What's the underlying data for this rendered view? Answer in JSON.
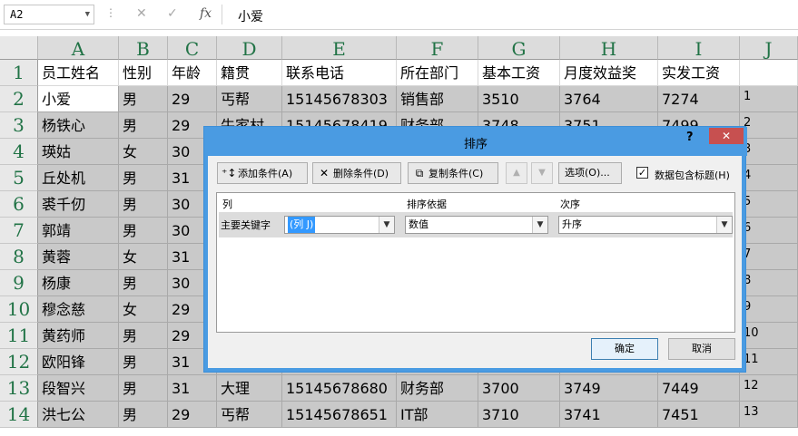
{
  "formula_bar": {
    "name_box": "A2",
    "cancel_icon": "✕",
    "enter_icon": "✓",
    "fx_label": "fx",
    "content": "小爱"
  },
  "columns": [
    "A",
    "B",
    "C",
    "D",
    "E",
    "F",
    "G",
    "H",
    "I",
    "J"
  ],
  "rows": [
    "1",
    "2",
    "3",
    "4",
    "5",
    "6",
    "7",
    "8",
    "9",
    "10",
    "11",
    "12",
    "13",
    "14"
  ],
  "header_row": [
    "员工姓名",
    "性别",
    "年龄",
    "籍贯",
    "联系电话",
    "所在部门",
    "基本工资",
    "月度效益奖",
    "实发工资",
    ""
  ],
  "data_rows": [
    [
      "小爱",
      "男",
      "29",
      "丐帮",
      "15145678303",
      "销售部",
      "3510",
      "3764",
      "7274",
      "1"
    ],
    [
      "杨铁心",
      "男",
      "29",
      "牛家村",
      "15145678419",
      "财务部",
      "3748",
      "3751",
      "7499",
      "2"
    ],
    [
      "瑛姑",
      "女",
      "30",
      "",
      "",
      "",
      "",
      "",
      "",
      "3"
    ],
    [
      "丘处机",
      "男",
      "31",
      "",
      "",
      "",
      "",
      "",
      "",
      "4"
    ],
    [
      "裘千仞",
      "男",
      "30",
      "",
      "",
      "",
      "",
      "",
      "",
      "5"
    ],
    [
      "郭靖",
      "男",
      "30",
      "",
      "",
      "",
      "",
      "",
      "",
      "6"
    ],
    [
      "黄蓉",
      "女",
      "31",
      "",
      "",
      "",
      "",
      "",
      "",
      "7"
    ],
    [
      "杨康",
      "男",
      "30",
      "",
      "",
      "",
      "",
      "",
      "",
      "8"
    ],
    [
      "穆念慈",
      "女",
      "29",
      "",
      "",
      "",
      "",
      "",
      "",
      "9"
    ],
    [
      "黄药师",
      "男",
      "29",
      "",
      "",
      "",
      "",
      "",
      "",
      "10"
    ],
    [
      "欧阳锋",
      "男",
      "31",
      "",
      "",
      "",
      "",
      "",
      "",
      "11"
    ],
    [
      "段智兴",
      "男",
      "31",
      "大理",
      "15145678680",
      "财务部",
      "3700",
      "3749",
      "7449",
      "12"
    ],
    [
      "洪七公",
      "男",
      "29",
      "丐帮",
      "15145678651",
      "IT部",
      "3710",
      "3741",
      "7451",
      "13"
    ]
  ],
  "dialog": {
    "title": "排序",
    "help": "?",
    "close": "✕",
    "add_label": "添加条件(A)",
    "delete_label": "删除条件(D)",
    "copy_label": "复制条件(C)",
    "up_arrow": "▲",
    "down_arrow": "▼",
    "options_label": "选项(O)...",
    "has_header_label": "数据包含标题(H)",
    "has_header_checked": "✓",
    "col_header": "列",
    "basis_header": "排序依据",
    "order_header": "次序",
    "primary_key_label": "主要关键字",
    "column_value": "(列 J)",
    "basis_value": "数值",
    "order_value": "升序",
    "dd_arrow": "▼",
    "ok_label": "确定",
    "cancel_label": "取消"
  },
  "colors": {
    "excel_green": "#217346",
    "dialog_title": "#4a9be2",
    "close_red": "#c75050",
    "selection_gray": "#c9c9c9"
  }
}
